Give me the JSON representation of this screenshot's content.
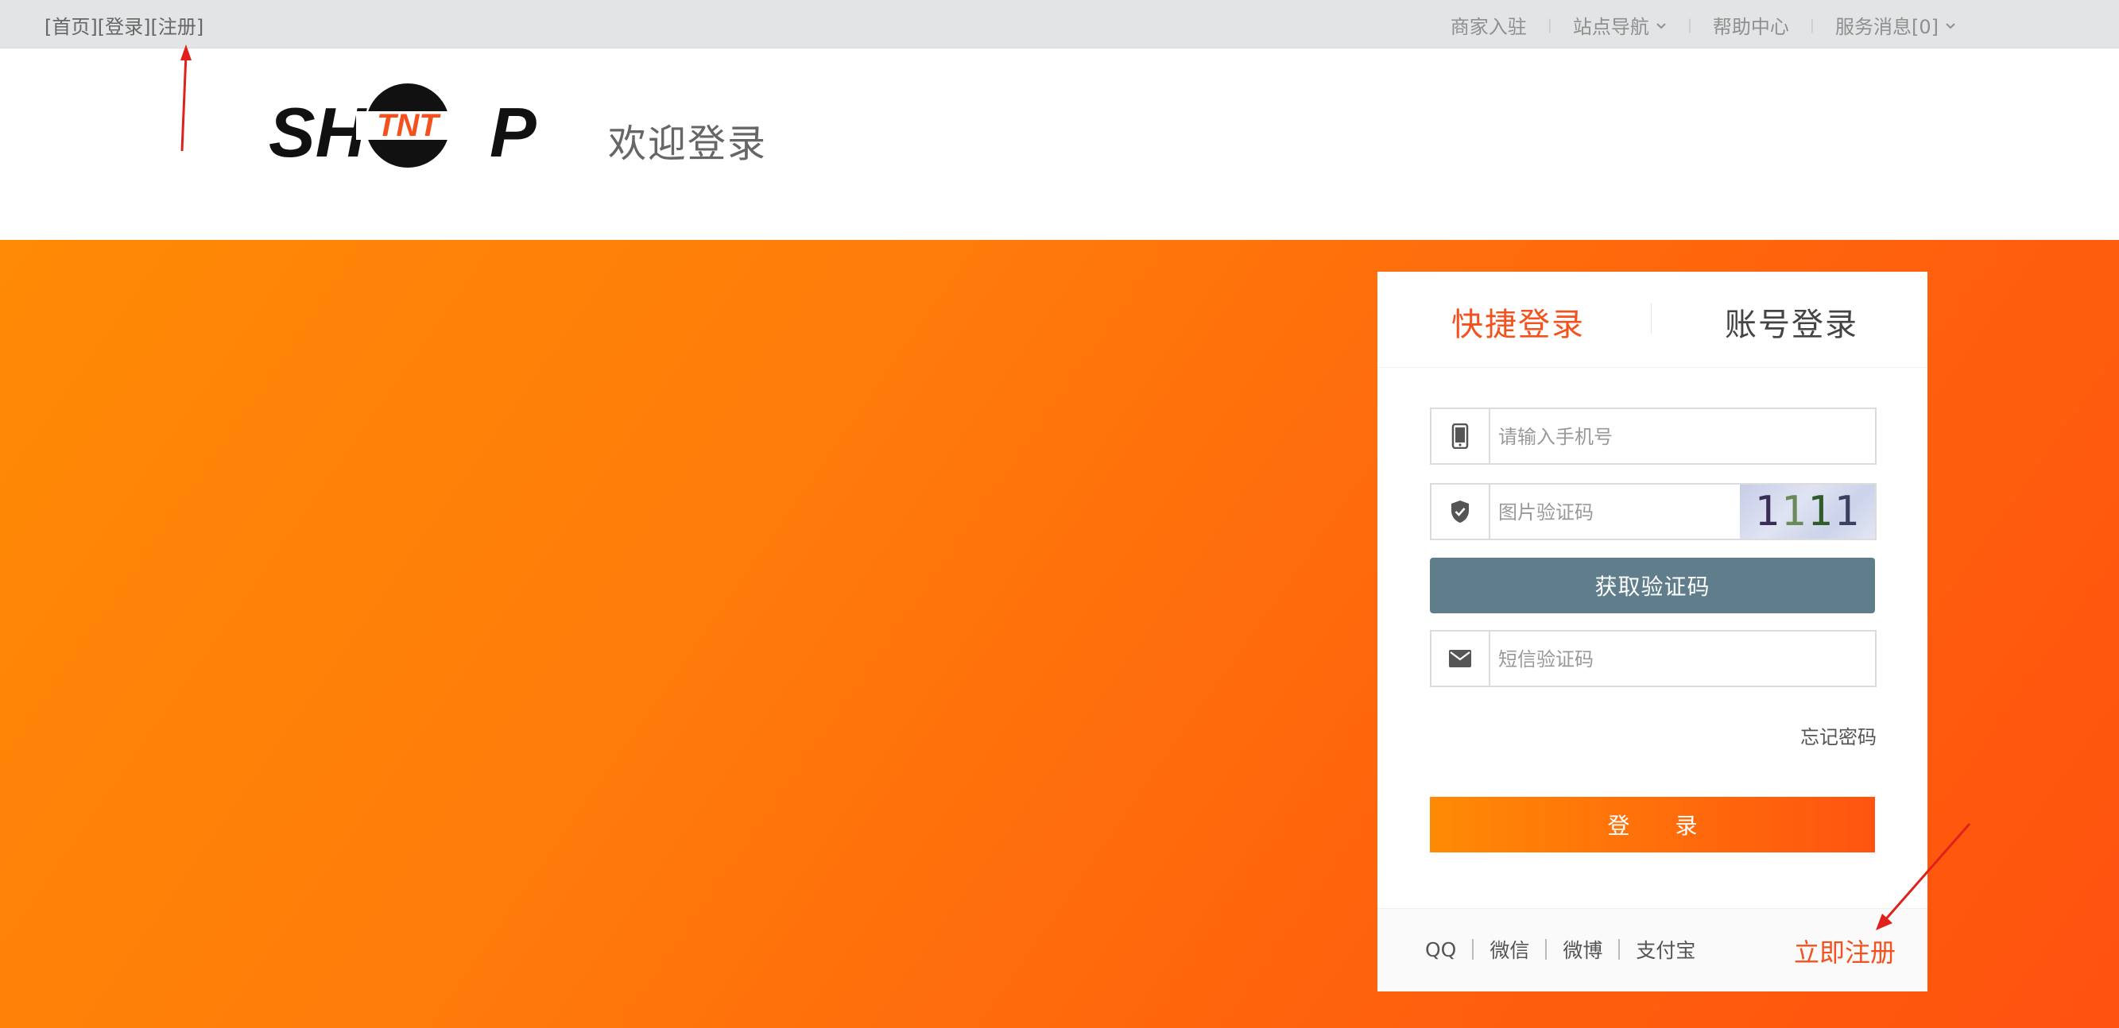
{
  "topbar": {
    "home": "[首页]",
    "login": "[登录]",
    "register": "[注册]",
    "merchant": "商家入驻",
    "site_nav": "站点导航",
    "help": "帮助中心",
    "messages": "服务消息[0]"
  },
  "header": {
    "logo_text": "SHTNTP",
    "welcome": "欢迎登录"
  },
  "login_panel": {
    "tab_quick": "快捷登录",
    "tab_account": "账号登录",
    "phone_placeholder": "请输入手机号",
    "captcha_placeholder": "图片验证码",
    "captcha_value": "1111",
    "get_code_button": "获取验证码",
    "sms_placeholder": "短信验证码",
    "forgot": "忘记密码",
    "login_button": "登 录",
    "social": [
      "QQ",
      "微信",
      "微博",
      "支付宝"
    ],
    "register_now": "立即注册"
  },
  "colors": {
    "accent": "#f4511e",
    "banner_start": "#ff8a05",
    "banner_end": "#ff520f",
    "sms_button": "#607d8b",
    "topbar": "#e3e4e5"
  },
  "icons": [
    "mobile-phone-icon",
    "shield-check-icon",
    "envelope-icon",
    "chevron-down-icon"
  ]
}
